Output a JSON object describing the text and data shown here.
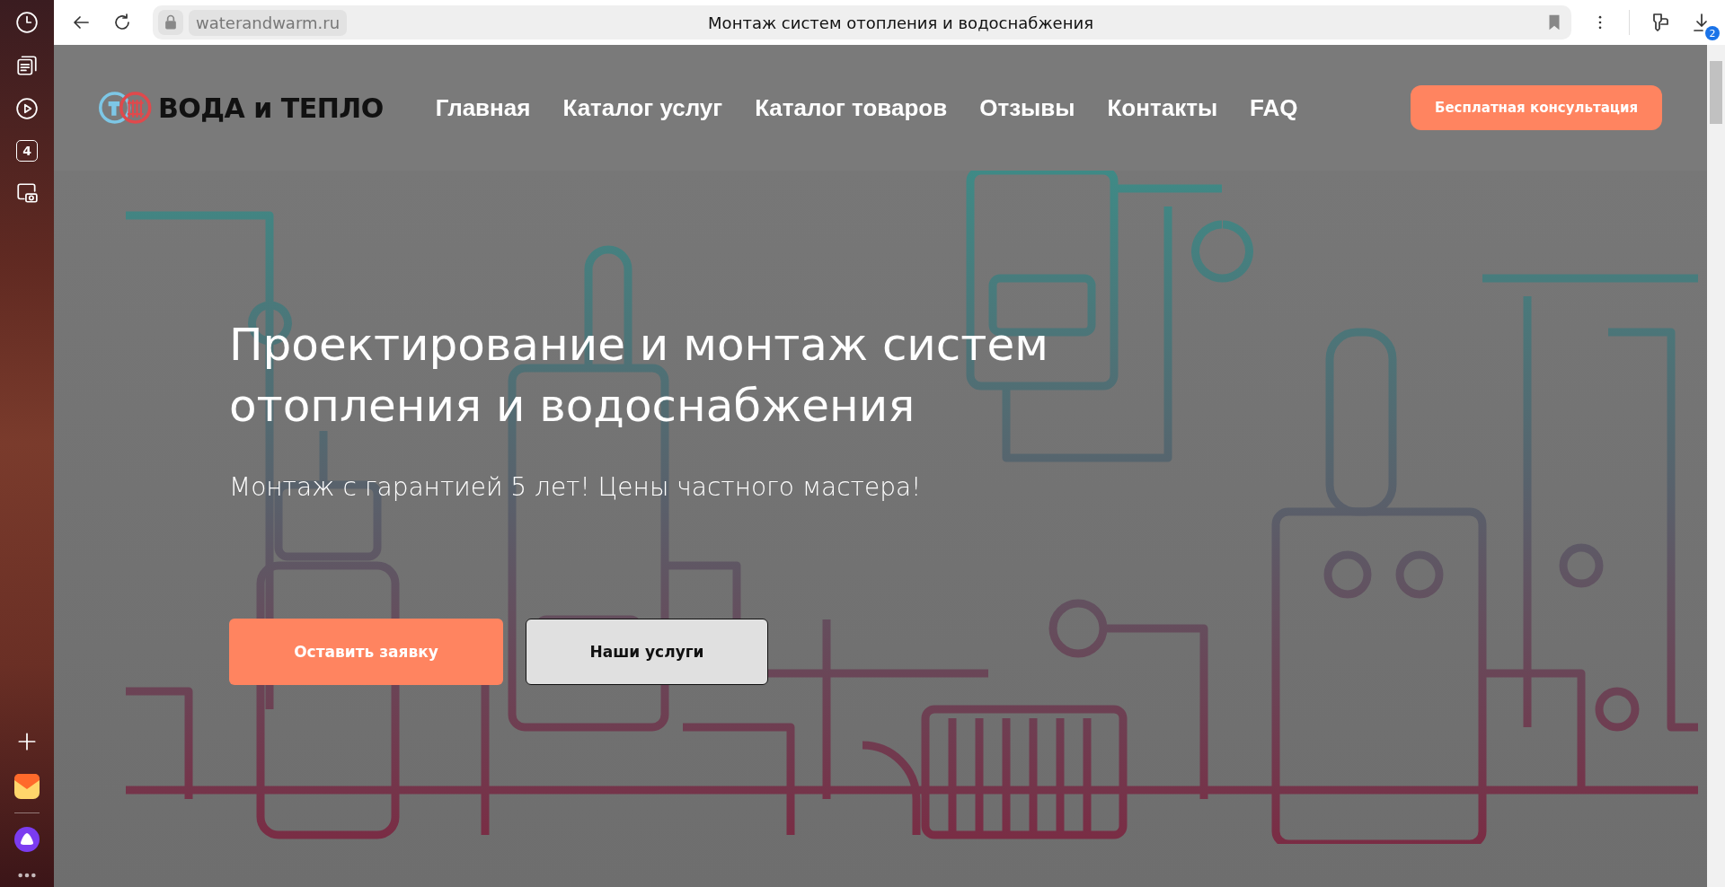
{
  "browser": {
    "sidebar": {
      "tab_count": "4"
    },
    "address": "waterandwarm.ru",
    "page_title": "Монтаж систем отопления и водоснабжения",
    "downloads_badge": "2"
  },
  "header": {
    "logo": "ВОДА и ТЕПЛО",
    "nav": [
      {
        "label": "Главная"
      },
      {
        "label": "Каталог услуг"
      },
      {
        "label": "Каталог товаров"
      },
      {
        "label": "Отзывы"
      },
      {
        "label": "Контакты"
      },
      {
        "label": "FAQ"
      }
    ],
    "cta": "Бесплатная консультация"
  },
  "hero": {
    "title": "Проектирование и монтаж систем отопления и водоснабжения",
    "subtitle": "Монтаж с гарантией 5 лет! Цены частного мастера!",
    "buttons": [
      {
        "label": "Оставить заявку",
        "kind": "primary"
      },
      {
        "label": "Наши услуги",
        "kind": "secondary"
      }
    ]
  }
}
